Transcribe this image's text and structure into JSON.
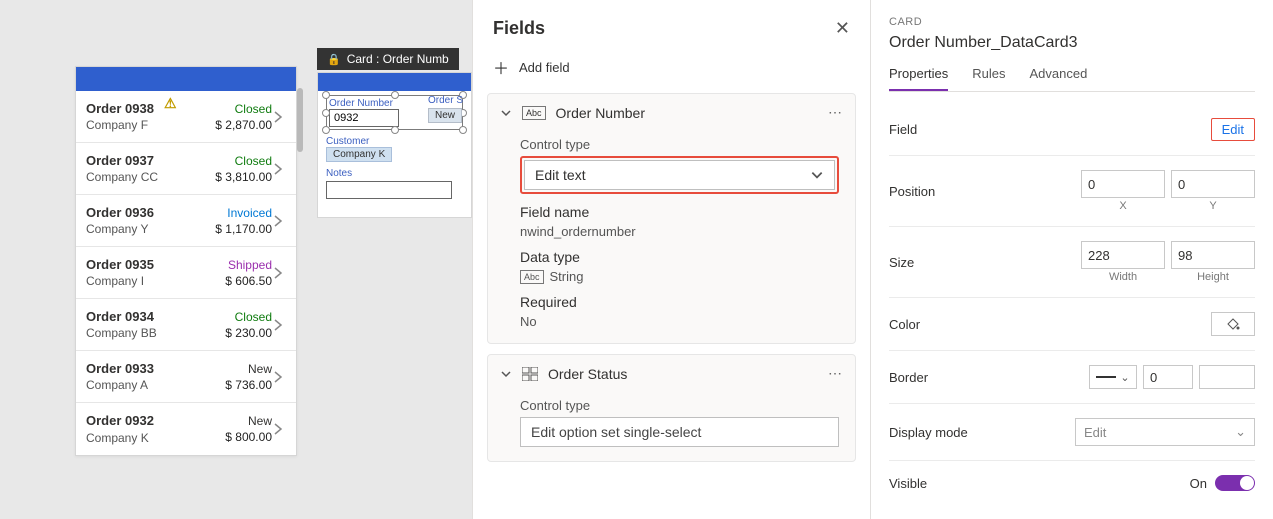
{
  "orders": [
    {
      "title": "Order 0938",
      "company": "Company F",
      "status": "Closed",
      "statusClass": "status-closed",
      "amount": "$ 2,870.00",
      "warn": true
    },
    {
      "title": "Order 0937",
      "company": "Company CC",
      "status": "Closed",
      "statusClass": "status-closed",
      "amount": "$ 3,810.00",
      "warn": false
    },
    {
      "title": "Order 0936",
      "company": "Company Y",
      "status": "Invoiced",
      "statusClass": "status-invoiced",
      "amount": "$ 1,170.00",
      "warn": false
    },
    {
      "title": "Order 0935",
      "company": "Company I",
      "status": "Shipped",
      "statusClass": "status-shipped",
      "amount": "$ 606.50",
      "warn": false
    },
    {
      "title": "Order 0934",
      "company": "Company BB",
      "status": "Closed",
      "statusClass": "status-closed",
      "amount": "$ 230.00",
      "warn": false
    },
    {
      "title": "Order 0933",
      "company": "Company A",
      "status": "New",
      "statusClass": "status-new",
      "amount": "$ 736.00",
      "warn": false
    },
    {
      "title": "Order 0932",
      "company": "Company K",
      "status": "New",
      "statusClass": "status-new",
      "amount": "$ 800.00",
      "warn": false
    }
  ],
  "card_tag": "Card : Order Numb",
  "form": {
    "orderNumberLabel": "Order Number",
    "orderNumberValue": "0932",
    "orderStatusLabel": "Order S",
    "newPill": "New",
    "customerLabel": "Customer",
    "customerValue": "Company K",
    "notesLabel": "Notes"
  },
  "fields": {
    "title": "Fields",
    "addField": "Add field",
    "cards": {
      "orderNumber": {
        "title": "Order Number",
        "controlTypeLabel": "Control type",
        "controlTypeValue": "Edit text",
        "fieldNameLabel": "Field name",
        "fieldNameValue": "nwind_ordernumber",
        "dataTypeLabel": "Data type",
        "dataTypeValue": "String",
        "requiredLabel": "Required",
        "requiredValue": "No"
      },
      "orderStatus": {
        "title": "Order Status",
        "controlTypeLabel": "Control type",
        "controlTypeValue": "Edit option set single-select"
      }
    }
  },
  "props": {
    "overline": "CARD",
    "name": "Order Number_DataCard3",
    "tabs": {
      "properties": "Properties",
      "rules": "Rules",
      "advanced": "Advanced"
    },
    "field": {
      "label": "Field",
      "edit": "Edit"
    },
    "position": {
      "label": "Position",
      "x": "0",
      "y": "0",
      "xLabel": "X",
      "yLabel": "Y"
    },
    "size": {
      "label": "Size",
      "w": "228",
      "h": "98",
      "wLabel": "Width",
      "hLabel": "Height"
    },
    "color": "Color",
    "border": {
      "label": "Border",
      "value": "0"
    },
    "displayMode": {
      "label": "Display mode",
      "value": "Edit"
    },
    "visible": {
      "label": "Visible",
      "on": "On"
    }
  }
}
